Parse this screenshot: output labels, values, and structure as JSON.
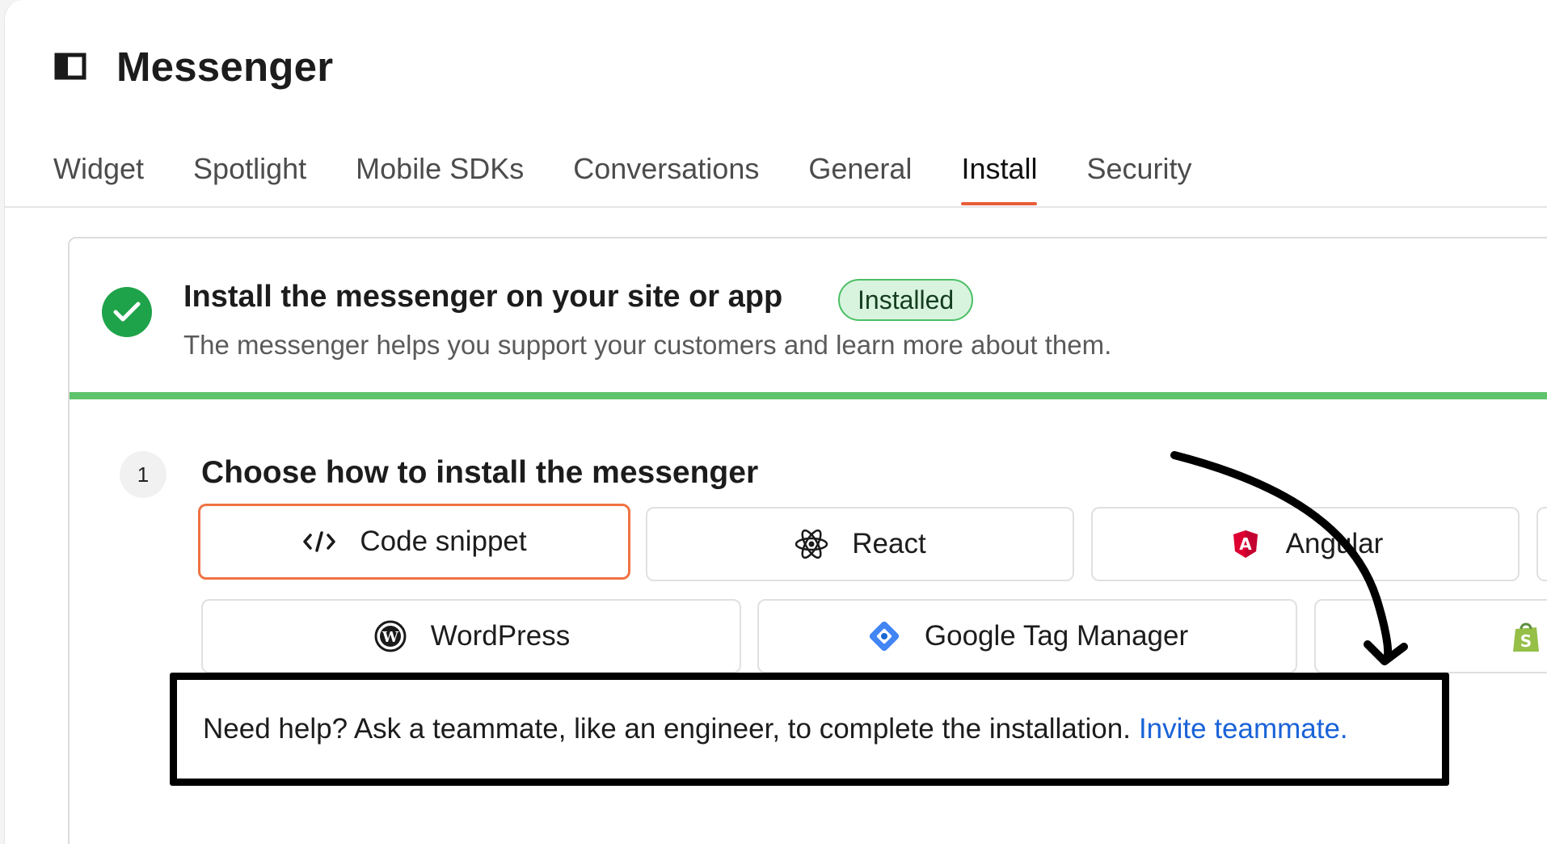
{
  "header": {
    "title": "Messenger",
    "panel_icon": "sidebar-toggle-icon"
  },
  "tabs": [
    {
      "label": "Widget",
      "active": false
    },
    {
      "label": "Spotlight",
      "active": false
    },
    {
      "label": "Mobile SDKs",
      "active": false
    },
    {
      "label": "Conversations",
      "active": false
    },
    {
      "label": "General",
      "active": false
    },
    {
      "label": "Install",
      "active": true
    },
    {
      "label": "Security",
      "active": false
    }
  ],
  "install_card": {
    "title": "Install the messenger on your site or app",
    "badge": "Installed",
    "subtitle": "The messenger helps you support your customers and learn more about them.",
    "progress": 1.0,
    "colors": {
      "accent": "#e85d3a",
      "success": "#1fa34a",
      "progress": "#5fc36c",
      "link": "#1a63d8"
    }
  },
  "step": {
    "number": "1",
    "title": "Choose how to install the messenger",
    "options": [
      {
        "label": "Code snippet",
        "icon": "code-icon",
        "selected": true
      },
      {
        "label": "React",
        "icon": "react-icon",
        "selected": false
      },
      {
        "label": "Angular",
        "icon": "angular-icon",
        "selected": false
      },
      {
        "label": "WordPress",
        "icon": "wordpress-icon",
        "selected": false
      },
      {
        "label": "Google Tag Manager",
        "icon": "google-tag-manager-icon",
        "selected": false
      },
      {
        "label": "",
        "icon": "shopify-icon",
        "selected": false
      }
    ]
  },
  "help": {
    "text": "Need help? Ask a teammate, like an engineer, to complete the installation.",
    "link": "Invite teammate."
  }
}
